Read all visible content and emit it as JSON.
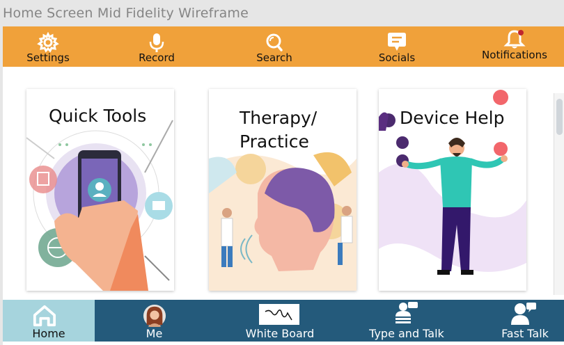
{
  "frame_title": "Home Screen Mid Fidelity Wireframe",
  "colors": {
    "topbar": "#f0a13a",
    "bottombar": "#245a7b",
    "home_active": "#a6d4dd"
  },
  "topbar": {
    "items": [
      {
        "label": "Settings",
        "icon": "gear-icon"
      },
      {
        "label": "Record",
        "icon": "microphone-icon"
      },
      {
        "label": "Search",
        "icon": "search-icon"
      },
      {
        "label": "Socials",
        "icon": "chat-bubble-icon"
      },
      {
        "label": "Notifications",
        "icon": "bell-icon"
      }
    ]
  },
  "cards": [
    {
      "title": "Quick Tools"
    },
    {
      "title_line1": "Therapy/",
      "title_line2": "Practice"
    },
    {
      "title": "Device Help"
    }
  ],
  "bottombar": {
    "items": [
      {
        "label": "Home",
        "icon": "home-icon"
      },
      {
        "label": "Me",
        "icon": "avatar"
      },
      {
        "label": "White Board",
        "icon": "whiteboard-icon"
      },
      {
        "label": "Type and Talk",
        "icon": "type-talk-icon"
      },
      {
        "label": "Fast Talk",
        "icon": "fast-talk-icon"
      }
    ]
  }
}
